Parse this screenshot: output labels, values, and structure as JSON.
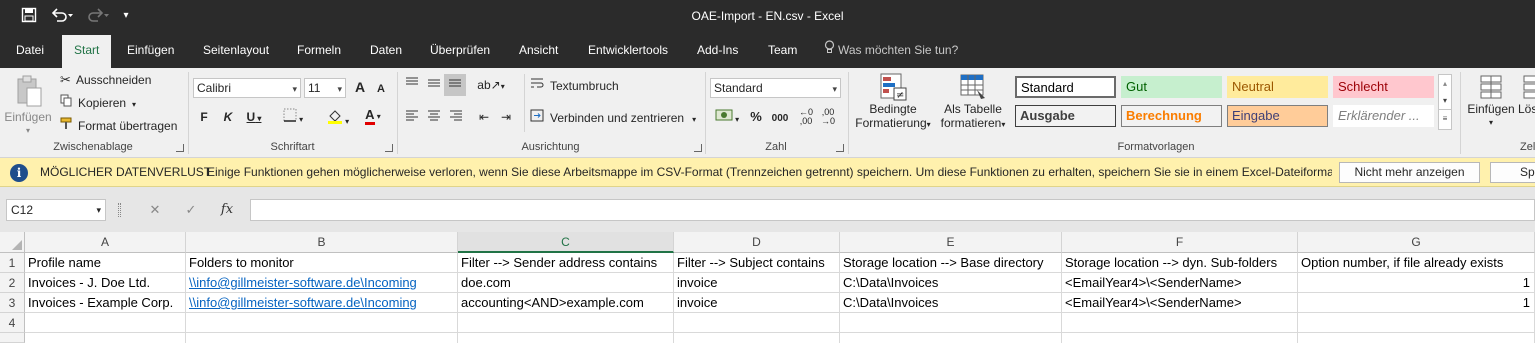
{
  "titlebar": {
    "title": "OAE-Import - EN.csv  -  Excel"
  },
  "tabs": [
    "Datei",
    "Start",
    "Einfügen",
    "Seitenlayout",
    "Formeln",
    "Daten",
    "Überprüfen",
    "Ansicht",
    "Entwicklertools",
    "Add-Ins",
    "Team"
  ],
  "tellme": "Was möchten Sie tun?",
  "ribbon": {
    "clipboard": {
      "paste": "Einfügen",
      "cut": "Ausschneiden",
      "copy": "Kopieren",
      "format_painter": "Format übertragen",
      "label": "Zwischenablage"
    },
    "font": {
      "name": "Calibri",
      "size": "11",
      "bold": "F",
      "italic": "K",
      "underline": "U",
      "grow": "A",
      "shrink": "A",
      "font_color": "A",
      "label": "Schriftart"
    },
    "alignment": {
      "wrap": "Textumbruch",
      "merge": "Verbinden und zentrieren",
      "label": "Ausrichtung"
    },
    "number": {
      "format": "Standard",
      "percent": "%",
      "thousands": "000",
      "label": "Zahl"
    },
    "styles": {
      "conditional": "Bedingte",
      "conditional2": "Formatierung",
      "as_table": "Als Tabelle",
      "as_table2": "formatieren",
      "boxes": [
        {
          "label": "Standard"
        },
        {
          "label": "Gut"
        },
        {
          "label": "Neutral"
        },
        {
          "label": "Schlecht"
        },
        {
          "label": "Ausgabe"
        },
        {
          "label": "Berechnung"
        },
        {
          "label": "Eingabe"
        },
        {
          "label": "Erklärender ..."
        }
      ],
      "label": "Formatvorlagen"
    },
    "cells": {
      "insert": "Einfügen",
      "delete": "Lös",
      "label": "Zel"
    }
  },
  "message_bar": {
    "title": "MÖGLICHER DATENVERLUST",
    "text": "Einige Funktionen gehen möglicherweise verloren, wenn Sie diese Arbeitsmappe im CSV-Format (Trennzeichen getrennt) speichern. Um diese Funktionen zu erhalten, speichern Sie sie in einem Excel-Dateiformat.",
    "btn_dismiss": "Nicht mehr anzeigen",
    "btn_save": "Speic"
  },
  "formula_bar": {
    "name_box": "C12",
    "fx": "fx",
    "formula": ""
  },
  "grid": {
    "columns": [
      "A",
      "B",
      "C",
      "D",
      "E",
      "F",
      "G"
    ],
    "rows": [
      "1",
      "2",
      "3",
      "4"
    ],
    "cells": [
      [
        "Profile name",
        "Folders to monitor",
        "Filter --> Sender address contains",
        "Filter --> Subject contains",
        "Storage location --> Base directory",
        "Storage location --> dyn. Sub-folders",
        "Option number, if file already exists"
      ],
      [
        "Invoices - J. Doe Ltd.",
        "\\\\info@gillmeister-software.de\\Incoming",
        "doe.com",
        "invoice",
        "C:\\Data\\Invoices",
        "<EmailYear4>\\<SenderName>",
        "1"
      ],
      [
        "Invoices - Example Corp.",
        "\\\\info@gillmeister-software.de\\Incoming",
        "accounting<AND>example.com",
        "invoice",
        "C:\\Data\\Invoices",
        "<EmailYear4>\\<SenderName>",
        "1"
      ],
      [
        "",
        "",
        "",
        "",
        "",
        "",
        ""
      ]
    ]
  },
  "colors": {
    "excel_green": "#217346",
    "link": "#0563c1",
    "msg_bg": "#fff1ad"
  }
}
